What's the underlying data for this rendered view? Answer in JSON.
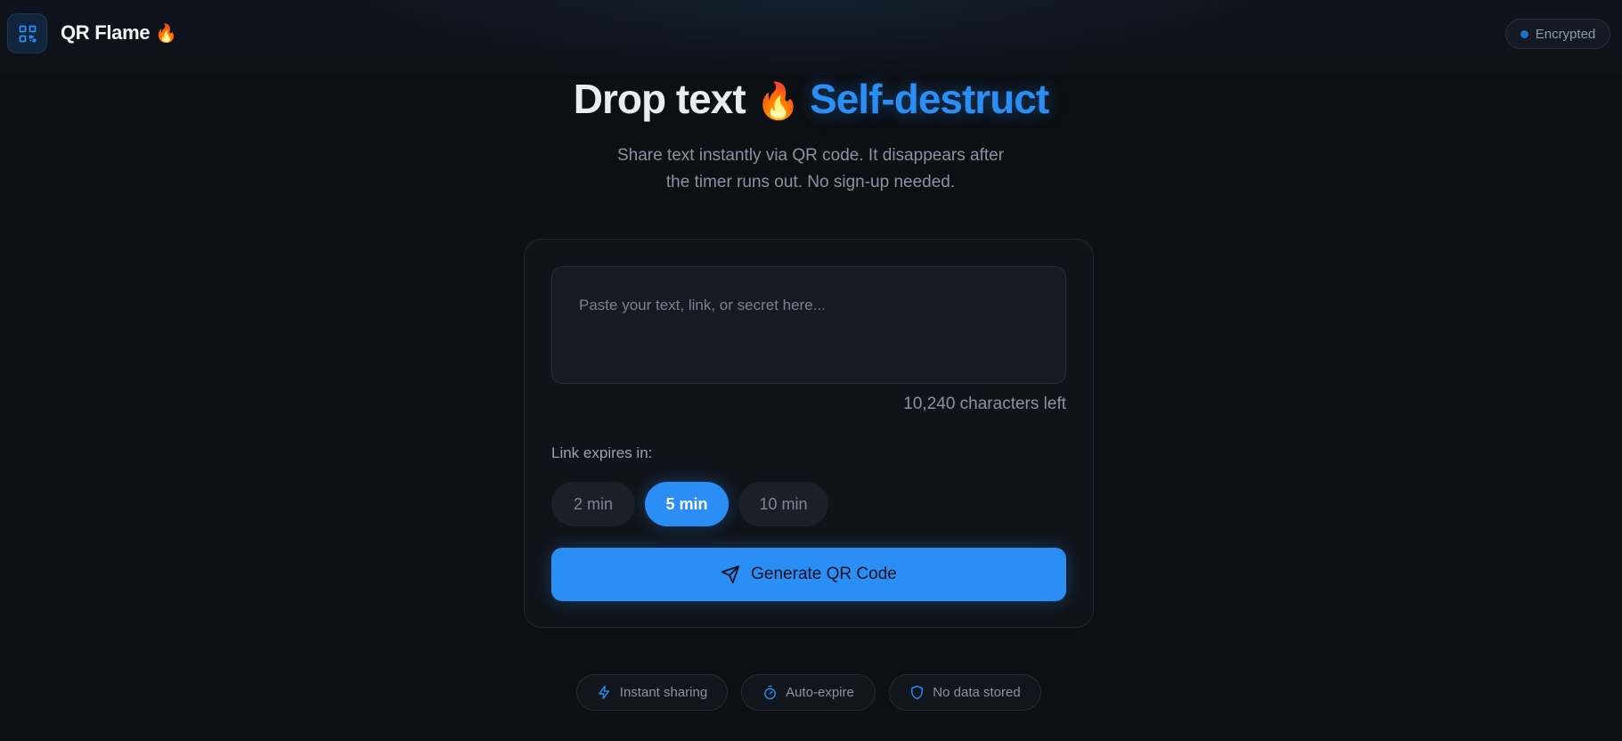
{
  "header": {
    "brand": "QR Flame",
    "brand_emoji": "🔥",
    "status_badge": "Encrypted"
  },
  "hero": {
    "title_part1": "Drop text",
    "title_emoji": "🔥",
    "title_part2": "Self-destruct",
    "subtitle_line1": "Share text instantly via QR code. It disappears after",
    "subtitle_line2": "the timer runs out. No sign-up needed."
  },
  "form": {
    "input_value": "",
    "input_placeholder": "Paste your text, link, or secret here...",
    "chars_left": "10,240 characters left",
    "expires_label": "Link expires in:",
    "expiry_options": [
      {
        "label": "2 min",
        "selected": false
      },
      {
        "label": "5 min",
        "selected": true
      },
      {
        "label": "10 min",
        "selected": false
      }
    ],
    "generate_label": "Generate QR Code"
  },
  "features": [
    {
      "label": "Instant sharing",
      "icon": "lightning-icon"
    },
    {
      "label": "Auto-expire",
      "icon": "timer-icon"
    },
    {
      "label": "No data stored",
      "icon": "shield-icon"
    }
  ],
  "colors": {
    "accent": "#2a8ef5",
    "background": "#0c0f14",
    "card": "#101319"
  }
}
